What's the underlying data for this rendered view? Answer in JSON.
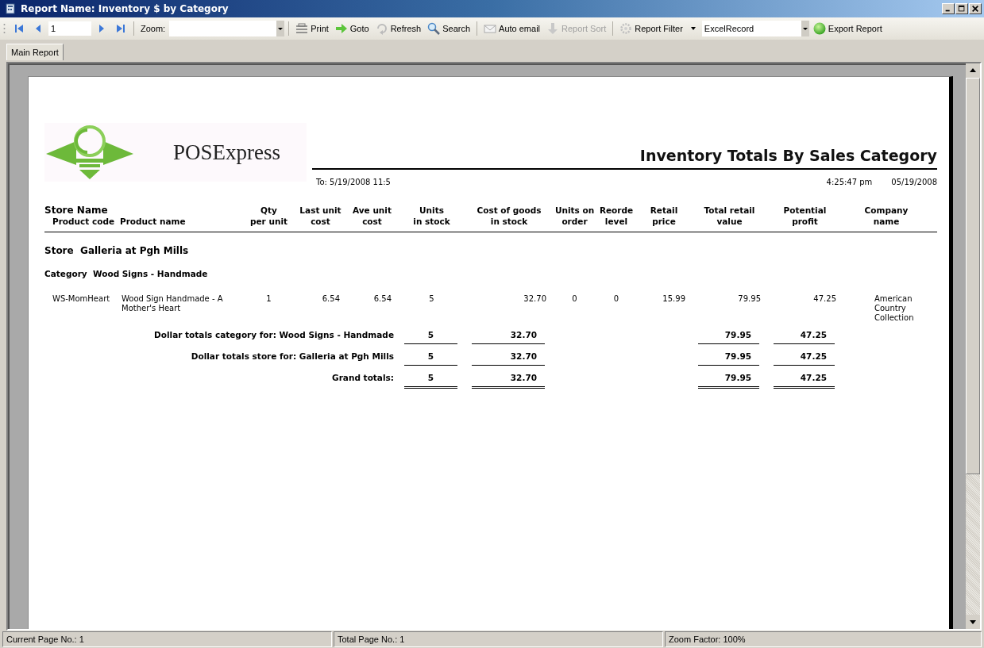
{
  "window": {
    "title": "Report Name:  Inventory $ by Category"
  },
  "toolbar": {
    "page_field": "1",
    "zoom_label": "Zoom:",
    "buttons": [
      {
        "kind": "print",
        "label": "Print",
        "disabled": false
      },
      {
        "kind": "goto",
        "label": "Goto",
        "disabled": false
      },
      {
        "kind": "refresh",
        "label": "Refresh",
        "disabled": false
      },
      {
        "kind": "search",
        "label": "Search",
        "disabled": false
      },
      {
        "kind": "email",
        "label": "Auto email",
        "disabled": false
      },
      {
        "kind": "sort",
        "label": "Report Sort",
        "disabled": true
      },
      {
        "kind": "filter",
        "label": "Report Filter",
        "disabled": false
      }
    ],
    "export_field": {
      "value": "ExcelRecord"
    },
    "export_button": "Export Report"
  },
  "tabs": [
    {
      "label": "Main Report",
      "selected": true
    }
  ],
  "report": {
    "logo_text": "POSExpress",
    "title": "Inventory Totals By Sales Category",
    "range": "To:  5/19/2008 11:5",
    "time": "4:25:47 pm",
    "date": "05/19/2008",
    "store_header": "Store Name",
    "columns": [
      "Product code",
      "Product name",
      "Qty\nper unit",
      "Last unit\ncost",
      "Ave unit\ncost",
      "Units\nin stock",
      "Cost of goods\nin stock",
      "Units on\norder",
      "Reorde\nlevel",
      "Retail\nprice",
      "Total retail\nvalue",
      "Potential\nprofit",
      "Company\nname"
    ],
    "store": {
      "label": "Store",
      "name": "Galleria at Pgh Mills"
    },
    "category": {
      "label": "Category",
      "name": "Wood Signs - Handmade"
    },
    "rows": [
      [
        "WS-MomHeart",
        "Wood Sign Handmade - A Mother's Heart",
        "1",
        "6.54",
        "6.54",
        "5",
        "32.70",
        "0",
        "0",
        "15.99",
        "79.95",
        "47.25",
        "American Country Collection"
      ]
    ],
    "totals": [
      {
        "kind": "single",
        "label": "Dollar totals category for: Wood Signs - Handmade",
        "units": "5",
        "cost": "32.70",
        "total_retail": "79.95",
        "profit": "47.25"
      },
      {
        "kind": "single",
        "label": "Dollar totals store for: Galleria at Pgh Mills",
        "units": "5",
        "cost": "32.70",
        "total_retail": "79.95",
        "profit": "47.25"
      },
      {
        "kind": "double",
        "label": "Grand totals:",
        "units": "5",
        "cost": "32.70",
        "total_retail": "79.95",
        "profit": "47.25"
      }
    ]
  },
  "status_bar": [
    "Current Page No.: 1",
    "Total Page No.: 1",
    "Zoom Factor: 100%"
  ]
}
